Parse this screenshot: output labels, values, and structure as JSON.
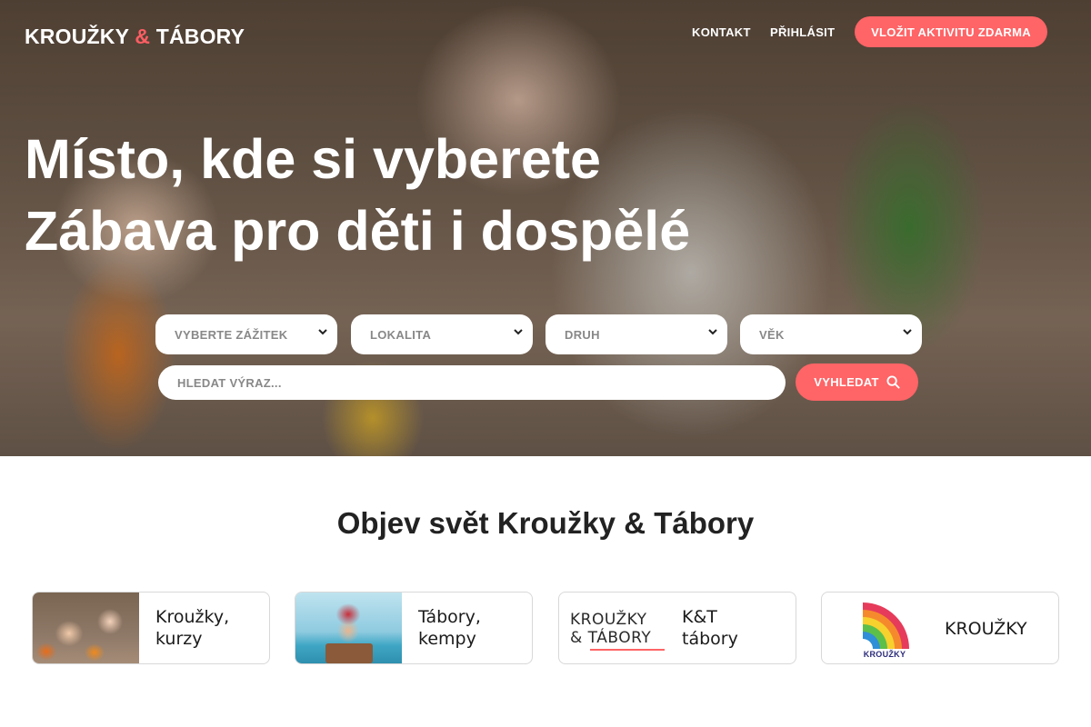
{
  "brand": {
    "logo_part1": "KROUŽKY",
    "logo_amp": "&",
    "logo_part2": "TÁBORY",
    "accent_color": "#ff6466"
  },
  "nav": {
    "contact": "KONTAKT",
    "login": "PŘIHLÁSIT",
    "cta": "VLOŽIT AKTIVITU ZDARMA"
  },
  "hero": {
    "line1": "Místo, kde si vyberete",
    "line2": "Zábava pro děti i dospělé"
  },
  "search": {
    "experience": "VYBERTE ZÁŽITEK",
    "location": "LOKALITA",
    "type": "DRUH",
    "age": "VĚK",
    "query_placeholder": "HLEDAT VÝRAZ...",
    "button": "VYHLEDAT",
    "chevron_icon": "chevron-down-icon",
    "search_icon": "search-icon"
  },
  "explore": {
    "title": "Objev svět Kroužky & Tábory",
    "cards": [
      {
        "line1": "Kroužky,",
        "line2": "kurzy"
      },
      {
        "line1": "Tábory,",
        "line2": "kempy"
      },
      {
        "line1": "K&T",
        "line2": "tábory",
        "logo_line1": "KROUŽKY",
        "logo_line2": "& TÁBORY"
      },
      {
        "line1": "KROUŽKY",
        "line2": "",
        "logo_text": "KROUŽKY"
      }
    ]
  }
}
